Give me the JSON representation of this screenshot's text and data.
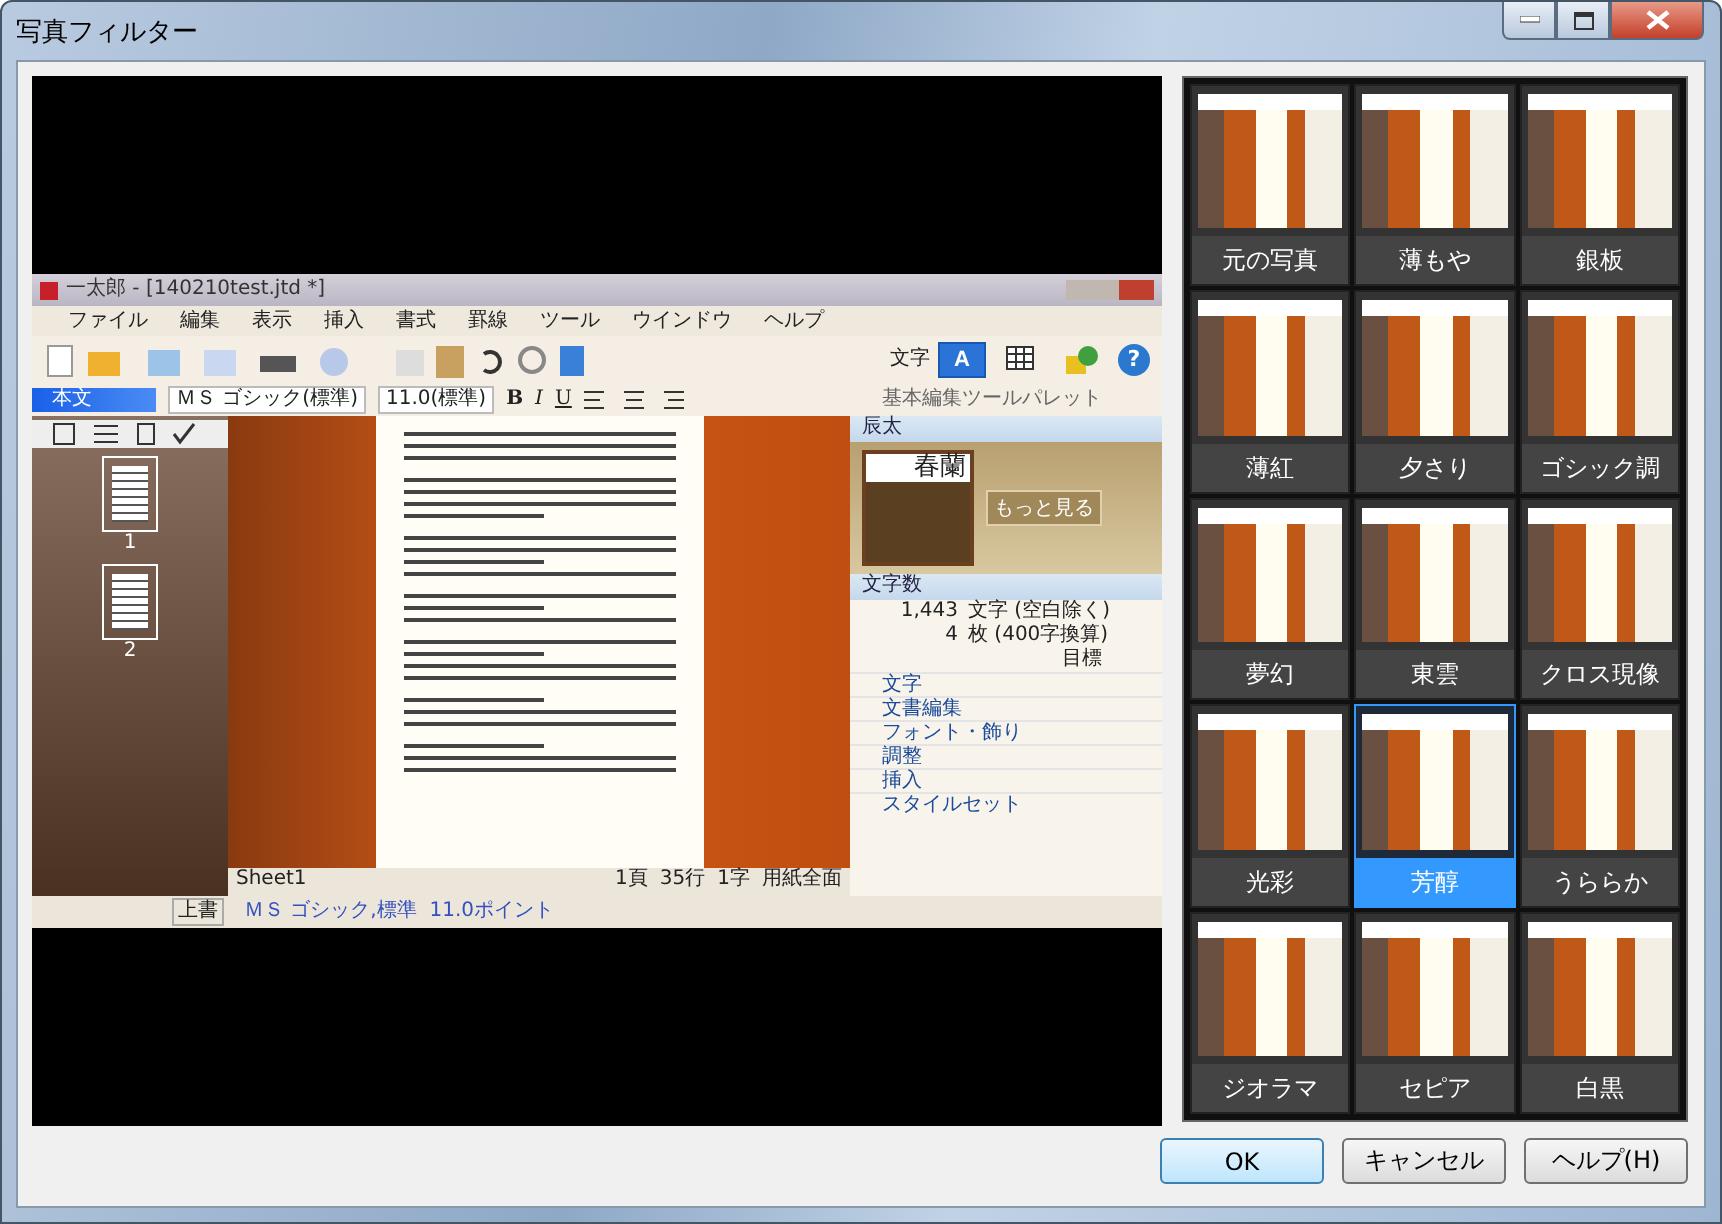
{
  "window": {
    "title": "写真フィルター"
  },
  "preview": {
    "app": {
      "title": "一太郎 - [140210test.jtd *]",
      "menu": [
        "ファイル",
        "編集",
        "表示",
        "挿入",
        "書式",
        "罫線",
        "ツール",
        "ウインドウ",
        "ヘルプ"
      ],
      "style_box": "本文",
      "font_box": "ＭＳ ゴシック(標準)",
      "size_box": "11.0(標準)",
      "format_buttons": [
        "B",
        "I",
        "U"
      ],
      "mode_label": "文字",
      "mode_buttons": [
        {
          "label": "A",
          "selected": true
        }
      ],
      "help_button": "?",
      "page_thumbnails": [
        "1",
        "2"
      ],
      "palette": {
        "title": "基本編集ツールパレット",
        "section": "辰太",
        "book_title": "春蘭",
        "more_button": "もっと見る",
        "count_section": "文字数",
        "counts": [
          {
            "value": "1,443",
            "unit": "文字 (空白除く)"
          },
          {
            "value": "4",
            "unit": "枚 (400字換算)"
          }
        ],
        "goal_label": "目標",
        "categories": [
          "文字",
          "文書編集",
          "フォント・飾り",
          "調整",
          "挿入",
          "スタイルセット"
        ]
      },
      "sheet_tab": "Sheet1",
      "page_status": [
        "1頁",
        "35行",
        "1字",
        "用紙全面"
      ],
      "status": [
        "上書",
        "ＭＳ ゴシック,標準  11.0ポイント"
      ]
    }
  },
  "filters": [
    {
      "label": "元の写真",
      "selected": false
    },
    {
      "label": "薄もや",
      "selected": false
    },
    {
      "label": "銀板",
      "selected": false
    },
    {
      "label": "薄紅",
      "selected": false
    },
    {
      "label": "夕さり",
      "selected": false
    },
    {
      "label": "ゴシック調",
      "selected": false
    },
    {
      "label": "夢幻",
      "selected": false
    },
    {
      "label": "東雲",
      "selected": false
    },
    {
      "label": "クロス現像",
      "selected": false
    },
    {
      "label": "光彩",
      "selected": false
    },
    {
      "label": "芳醇",
      "selected": true
    },
    {
      "label": "うららか",
      "selected": false
    },
    {
      "label": "ジオラマ",
      "selected": false
    },
    {
      "label": "セピア",
      "selected": false
    },
    {
      "label": "白黒",
      "selected": false
    }
  ],
  "buttons": [
    {
      "label": "OK",
      "focused": true
    },
    {
      "label": "キャンセル",
      "focused": false
    },
    {
      "label": "ヘルプ(H)",
      "focused": false
    }
  ]
}
